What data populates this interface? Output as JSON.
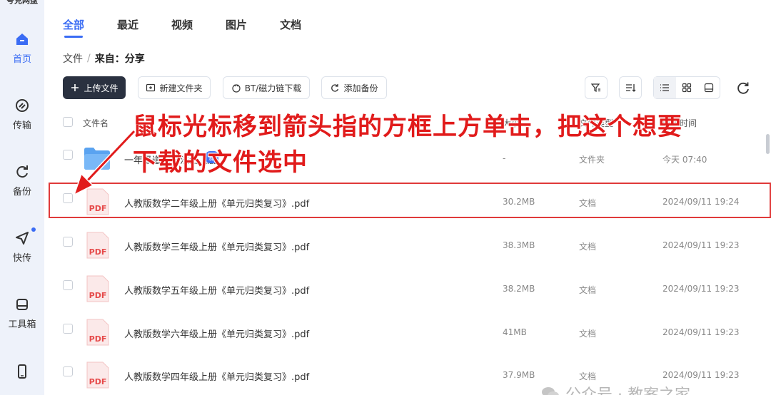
{
  "app": {
    "title": "夸克网盘"
  },
  "sidebar": {
    "items": [
      {
        "label": "首页",
        "icon": "home-icon"
      },
      {
        "label": "传输",
        "icon": "transfer-icon"
      },
      {
        "label": "备份",
        "icon": "backup-icon"
      },
      {
        "label": "快传",
        "icon": "quick-send-icon"
      },
      {
        "label": "工具箱",
        "icon": "toolbox-icon"
      },
      {
        "label": "",
        "icon": "phone-icon"
      }
    ]
  },
  "tabs": [
    {
      "label": "全部"
    },
    {
      "label": "最近"
    },
    {
      "label": "视频"
    },
    {
      "label": "图片"
    },
    {
      "label": "文档"
    }
  ],
  "breadcrumb": {
    "root": "文件",
    "sep": "/",
    "current": "来自：分享"
  },
  "toolbar": {
    "upload": "上传文件",
    "new_folder": "新建文件夹",
    "bt": "BT/磁力链下载",
    "backup": "添加备份"
  },
  "table": {
    "headers": {
      "name": "文件名",
      "size": "大小",
      "type": "文件类型",
      "time": "修改时间"
    },
    "rows": [
      {
        "name": "一年级道德与法治上册",
        "badge": "新",
        "size": "-",
        "type": "文件夹",
        "time": "今天 07:40",
        "kind": "folder"
      },
      {
        "name": "人教版数学二年级上册《单元归类复习》.pdf",
        "size": "30.2MB",
        "type": "文档",
        "time": "2024/09/11 19:24",
        "kind": "pdf"
      },
      {
        "name": "人教版数学三年级上册《单元归类复习》.pdf",
        "size": "38.3MB",
        "type": "文档",
        "time": "2024/09/11 19:23",
        "kind": "pdf"
      },
      {
        "name": "人教版数学五年级上册《单元归类复习》.pdf",
        "size": "38.2MB",
        "type": "文档",
        "time": "2024/09/11 19:23",
        "kind": "pdf"
      },
      {
        "name": "人教版数学六年级上册《单元归类复习》.pdf",
        "size": "41MB",
        "type": "文档",
        "time": "2024/09/11 19:23",
        "kind": "pdf"
      },
      {
        "name": "人教版数学四年级上册《单元归类复习》.pdf",
        "size": "37.9MB",
        "type": "文档",
        "time": "2024/09/11 19:23",
        "kind": "pdf"
      }
    ]
  },
  "annotation": {
    "line1": "鼠标光标移到箭头指的方框上方单击，把这个想要",
    "line2": "下载的文件选中"
  },
  "watermark": {
    "text": "公众号 · 教案之家"
  },
  "pdf_label": "PDF",
  "colors": {
    "accent": "#3a6cf4",
    "annotation": "#e11b1b",
    "pdf": "#e64b4b"
  }
}
